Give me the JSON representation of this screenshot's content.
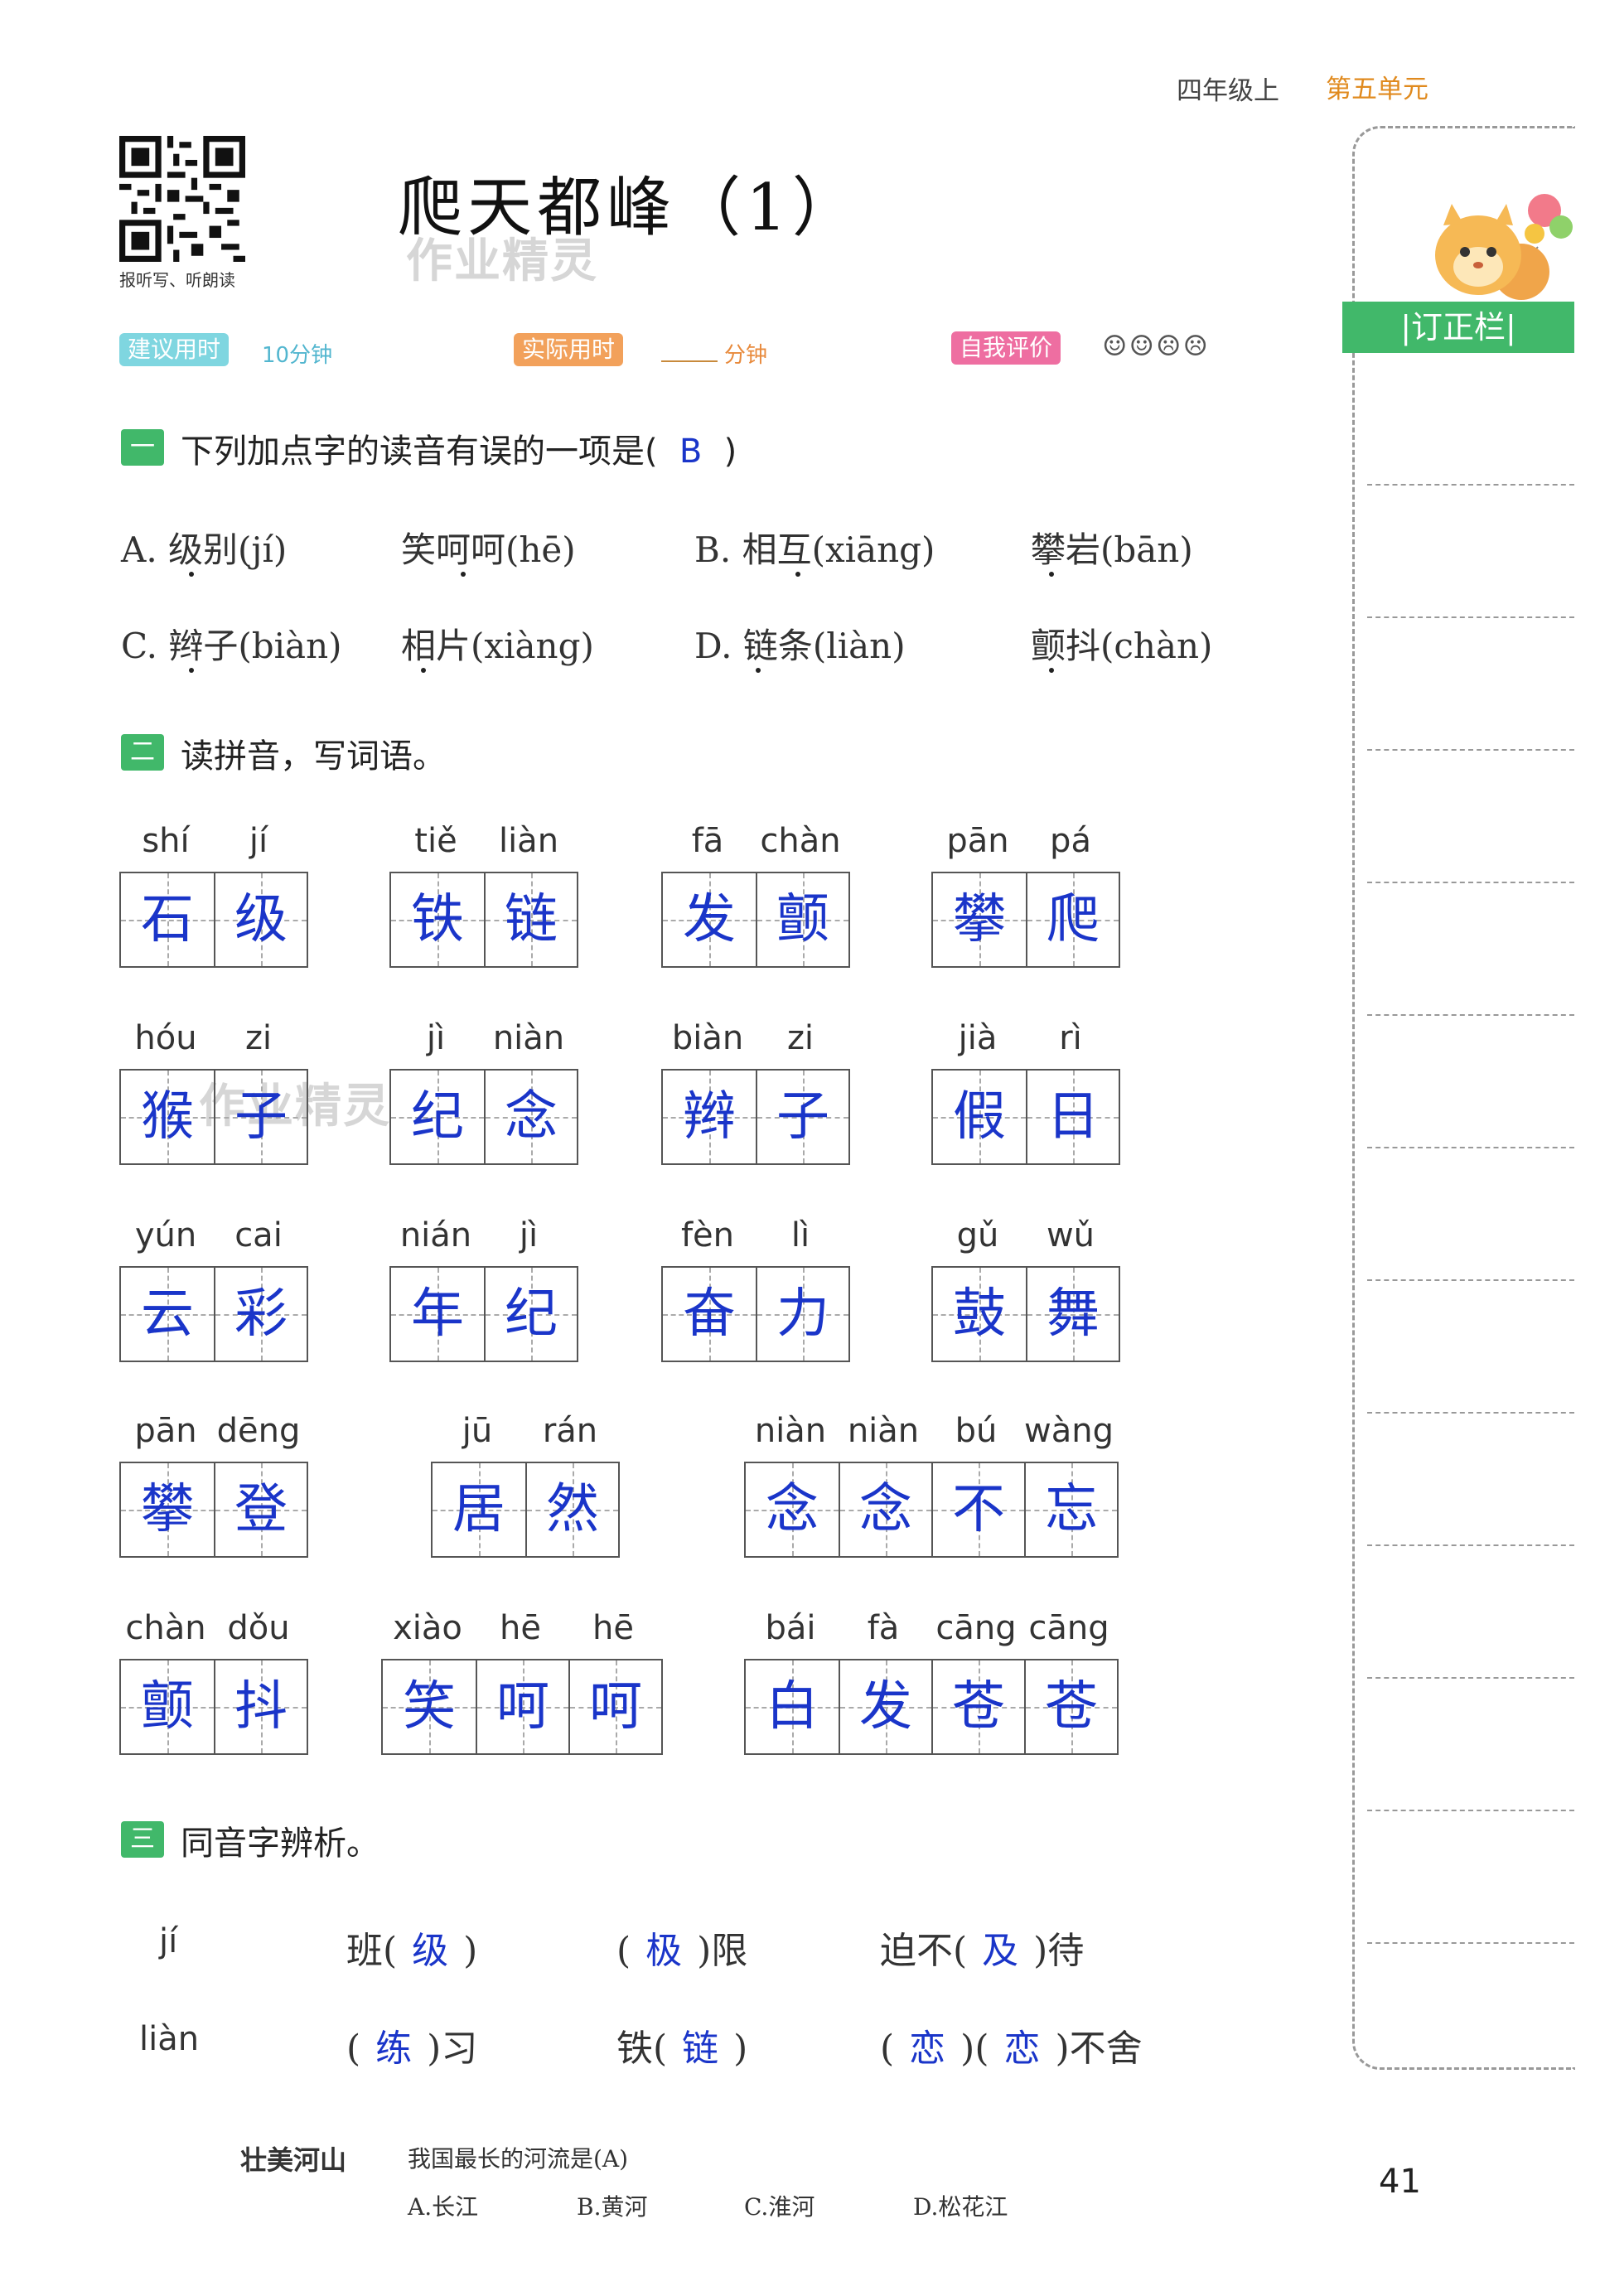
{
  "header": {
    "grade": "四年级上",
    "unit": "第五单元"
  },
  "qr_caption": "报听写、听朗读",
  "title": "爬天都峰（1）",
  "watermark": "作业精灵",
  "meta": {
    "suggested_label": "建议用时",
    "suggested_value": "10分钟",
    "actual_label": "实际用时",
    "actual_unit": "分钟",
    "self_label": "自我评价",
    "faces": "☺☺☹☹"
  },
  "section1": {
    "icon": "一",
    "title_prefix": "下列加点字的读音有误的一项是(",
    "answer": "B",
    "title_suffix": ")",
    "options": [
      "A. 级别(jí)",
      "笑呵呵(hē)",
      "B. 相互(xiāng)",
      "攀岩(bān)",
      "C. 辫子(biàn)",
      "相片(xiàng)",
      "D. 链条(liàn)",
      "颤抖(chàn)"
    ]
  },
  "section2": {
    "icon": "二",
    "title": "读拼音，写词语。",
    "rows": [
      [
        {
          "pinyin": [
            "shí",
            "jí"
          ],
          "chars": [
            "石",
            "级"
          ]
        },
        {
          "pinyin": [
            "tiě",
            "liàn"
          ],
          "chars": [
            "铁",
            "链"
          ]
        },
        {
          "pinyin": [
            "fā",
            "chàn"
          ],
          "chars": [
            "发",
            "颤"
          ]
        },
        {
          "pinyin": [
            "pān",
            "pá"
          ],
          "chars": [
            "攀",
            "爬"
          ]
        }
      ],
      [
        {
          "pinyin": [
            "hóu",
            "zi"
          ],
          "chars": [
            "猴",
            "子"
          ]
        },
        {
          "pinyin": [
            "jì",
            "niàn"
          ],
          "chars": [
            "纪",
            "念"
          ]
        },
        {
          "pinyin": [
            "biàn",
            "zi"
          ],
          "chars": [
            "辫",
            "子"
          ]
        },
        {
          "pinyin": [
            "jià",
            "rì"
          ],
          "chars": [
            "假",
            "日"
          ]
        }
      ],
      [
        {
          "pinyin": [
            "yún",
            "cai"
          ],
          "chars": [
            "云",
            "彩"
          ]
        },
        {
          "pinyin": [
            "nián",
            "jì"
          ],
          "chars": [
            "年",
            "纪"
          ]
        },
        {
          "pinyin": [
            "fèn",
            "lì"
          ],
          "chars": [
            "奋",
            "力"
          ]
        },
        {
          "pinyin": [
            "gǔ",
            "wǔ"
          ],
          "chars": [
            "鼓",
            "舞"
          ]
        }
      ],
      [
        {
          "pinyin": [
            "pān",
            "dēng"
          ],
          "chars": [
            "攀",
            "登"
          ]
        },
        {
          "pinyin": [
            "jū",
            "rán"
          ],
          "chars": [
            "居",
            "然"
          ]
        },
        {
          "pinyin": [
            "niàn",
            "niàn",
            "bú",
            "wàng"
          ],
          "chars": [
            "念",
            "念",
            "不",
            "忘"
          ]
        }
      ],
      [
        {
          "pinyin": [
            "chàn",
            "dǒu"
          ],
          "chars": [
            "颤",
            "抖"
          ]
        },
        {
          "pinyin": [
            "xiào",
            "hē",
            "hē"
          ],
          "chars": [
            "笑",
            "呵",
            "呵"
          ]
        },
        {
          "pinyin": [
            "bái",
            "fà",
            "cāng",
            "cāng"
          ],
          "chars": [
            "白",
            "发",
            "苍",
            "苍"
          ]
        }
      ]
    ]
  },
  "section3": {
    "icon": "三",
    "title": "同音字辨析。",
    "row1": {
      "pinyin": "jí",
      "items": [
        [
          "班(",
          "级",
          ")"
        ],
        [
          "(",
          "极",
          ")限"
        ],
        [
          "迫不(",
          "及",
          ")待"
        ]
      ]
    },
    "row2": {
      "pinyin": "liàn",
      "items": [
        [
          "(",
          "练",
          ")习"
        ],
        [
          "铁(",
          "链",
          ")"
        ],
        [
          "(",
          "恋",
          ")(",
          "恋",
          ")不舍"
        ]
      ]
    }
  },
  "sidebar": {
    "title": "|订正栏|"
  },
  "footer": {
    "label": "壮美河山",
    "question": "我国最长的河流是(A)",
    "options": [
      "A.长江",
      "B.黄河",
      "C.淮河",
      "D.松花江"
    ]
  },
  "page_number": "41",
  "colors": {
    "answer": "#1a35c9",
    "section": "#41b86a",
    "unit": "#e08a1e"
  }
}
